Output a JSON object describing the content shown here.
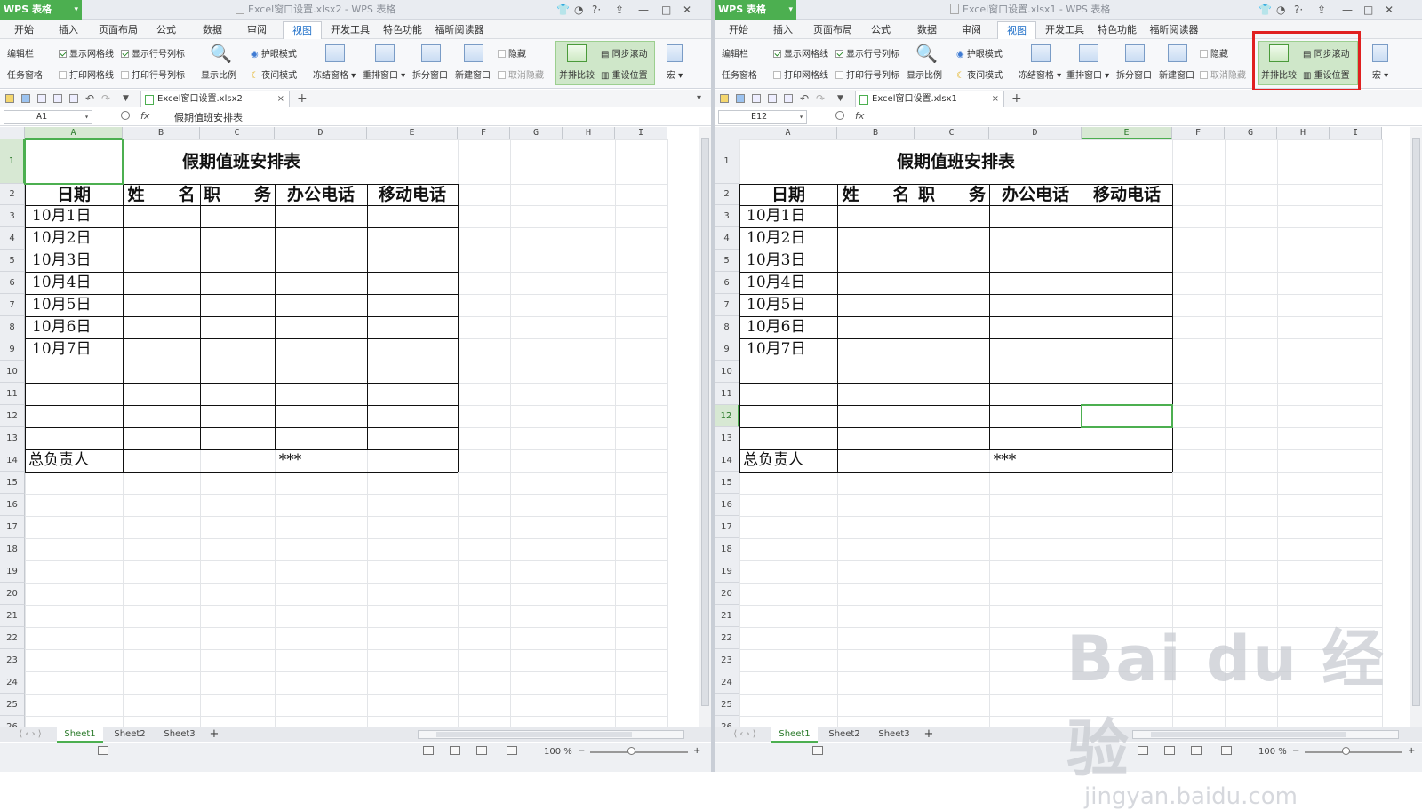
{
  "app": {
    "name": "WPS 表格",
    "brand_color": "#4caf50",
    "accent_selected": "#4caf50",
    "highlight_color": "#e02020"
  },
  "menus": [
    "开始",
    "插入",
    "页面布局",
    "公式",
    "数据",
    "审阅",
    "视图",
    "开发工具",
    "特色功能",
    "福昕阅读器"
  ],
  "active_menu": "视图",
  "ribbon": {
    "edit_bar": "编辑栏",
    "task_pane": "任务窗格",
    "show_gridlines": "显示网格线",
    "show_row_col": "显示行号列标",
    "print_gridlines": "打印网格线",
    "print_row_col": "打印行号列标",
    "zoom_ratio": "显示比例",
    "eye_mode": "护眼模式",
    "night_mode": "夜间模式",
    "freeze": "冻结窗格",
    "rearrange": "重排窗口",
    "split": "拆分窗口",
    "new_window": "新建窗口",
    "hide": "隐藏",
    "unhide": "取消隐藏",
    "side_by_side": "并排比较",
    "sync_scroll": "同步滚动",
    "reset_position": "重设位置",
    "macro": "宏"
  },
  "left": {
    "window_title": "Excel窗口设置.xlsx2 - WPS 表格",
    "doc_tab": "Excel窗口设置.xlsx2",
    "name_box": "A1",
    "formula": "假期值班安排表"
  },
  "right": {
    "window_title": "Excel窗口设置.xlsx1 - WPS 表格",
    "doc_tab": "Excel窗口设置.xlsx1",
    "name_box": "E12",
    "formula": ""
  },
  "sheet": {
    "columns": [
      "A",
      "B",
      "C",
      "D",
      "E",
      "F",
      "G",
      "H",
      "I"
    ],
    "rows": [
      "1",
      "2",
      "3",
      "4",
      "5",
      "6",
      "7",
      "8",
      "9",
      "10",
      "11",
      "12",
      "13",
      "14",
      "15",
      "16",
      "17",
      "18",
      "19",
      "20",
      "21",
      "22",
      "23",
      "24",
      "25",
      "26"
    ],
    "title": "假期值班安排表",
    "headers": [
      "日期",
      "姓　　名",
      "职　　务",
      "办公电话",
      "移动电话"
    ],
    "dates": [
      "10月1日",
      "10月2日",
      "10月3日",
      "10月4日",
      "10月5日",
      "10月6日",
      "10月7日"
    ],
    "footer_label": "总负责人",
    "footer_value": "***"
  },
  "sheet_tabs": [
    "Sheet1",
    "Sheet2",
    "Sheet3"
  ],
  "status": {
    "zoom": "100 %"
  },
  "watermark": {
    "brand": "Bai du 经验",
    "url": "jingyan.baidu.com"
  }
}
